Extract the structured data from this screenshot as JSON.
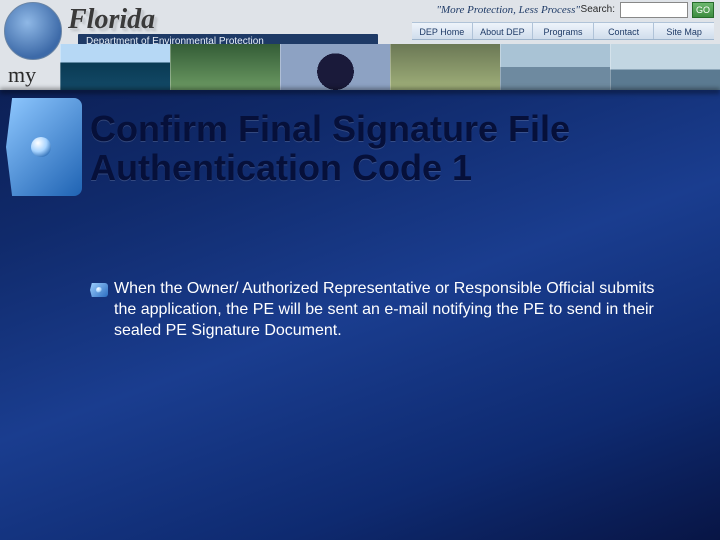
{
  "banner": {
    "state": "Florida",
    "department": "Department of Environmental Protection",
    "slogan": "\"More Protection, Less Process\"",
    "my_label": "my",
    "search_label": "Search:",
    "search_value": "",
    "go_label": "GO",
    "nav": {
      "home": "DEP Home",
      "about": "About DEP",
      "programs": "Programs",
      "contact": "Contact",
      "sitemap": "Site Map"
    }
  },
  "heading": "Confirm Final Signature File Authentication Code 1",
  "body": "When the Owner/ Authorized Representative or Responsible Official submits the application, the PE will be sent an e-mail notifying the PE to send in their sealed PE Signature Document."
}
